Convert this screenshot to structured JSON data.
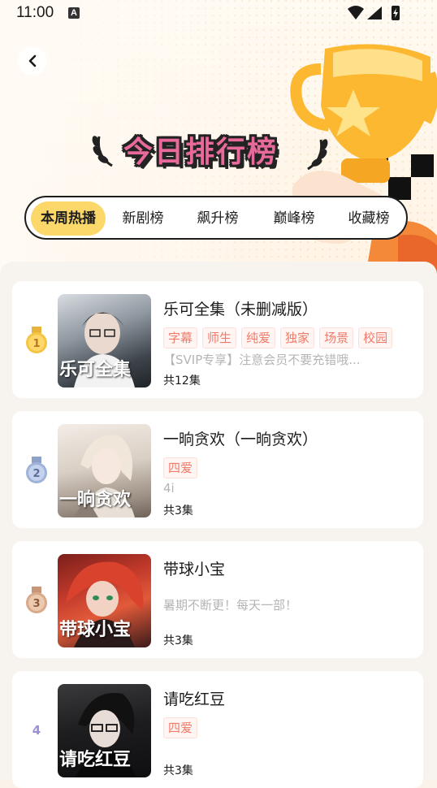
{
  "status_bar": {
    "time": "11:00",
    "badge": "A"
  },
  "header": {
    "title": "今日排行榜"
  },
  "tabs": [
    {
      "label": "本周热播",
      "active": true
    },
    {
      "label": "新剧榜",
      "active": false
    },
    {
      "label": "飙升榜",
      "active": false
    },
    {
      "label": "巅峰榜",
      "active": false
    },
    {
      "label": "收藏榜",
      "active": false
    }
  ],
  "items": [
    {
      "rank": "1",
      "title": "乐可全集（未删减版）",
      "cover_text": "乐可全集",
      "tags": [
        "字幕",
        "师生",
        "纯爱",
        "独家",
        "场景",
        "校园"
      ],
      "description": "【SVIP专享】注意会员不要充错哦...",
      "episodes": "共12集",
      "medal_color": "#f4c542"
    },
    {
      "rank": "2",
      "title": "一晌贪欢（一晌贪欢）",
      "cover_text": "一晌贪欢",
      "tags": [
        "四爱"
      ],
      "description": "4i",
      "episodes": "共3集",
      "medal_color": "#9fb2d8"
    },
    {
      "rank": "3",
      "title": "带球小宝",
      "cover_text": "带球小宝",
      "tags": [],
      "description": "暑期不断更！每天一部！",
      "episodes": "共3集",
      "medal_color": "#d9a98a"
    },
    {
      "rank": "4",
      "title": "请吃红豆",
      "cover_text": "请吃红豆",
      "tags": [
        "四爱"
      ],
      "description": "",
      "episodes": "共3集",
      "medal_color": ""
    }
  ]
}
